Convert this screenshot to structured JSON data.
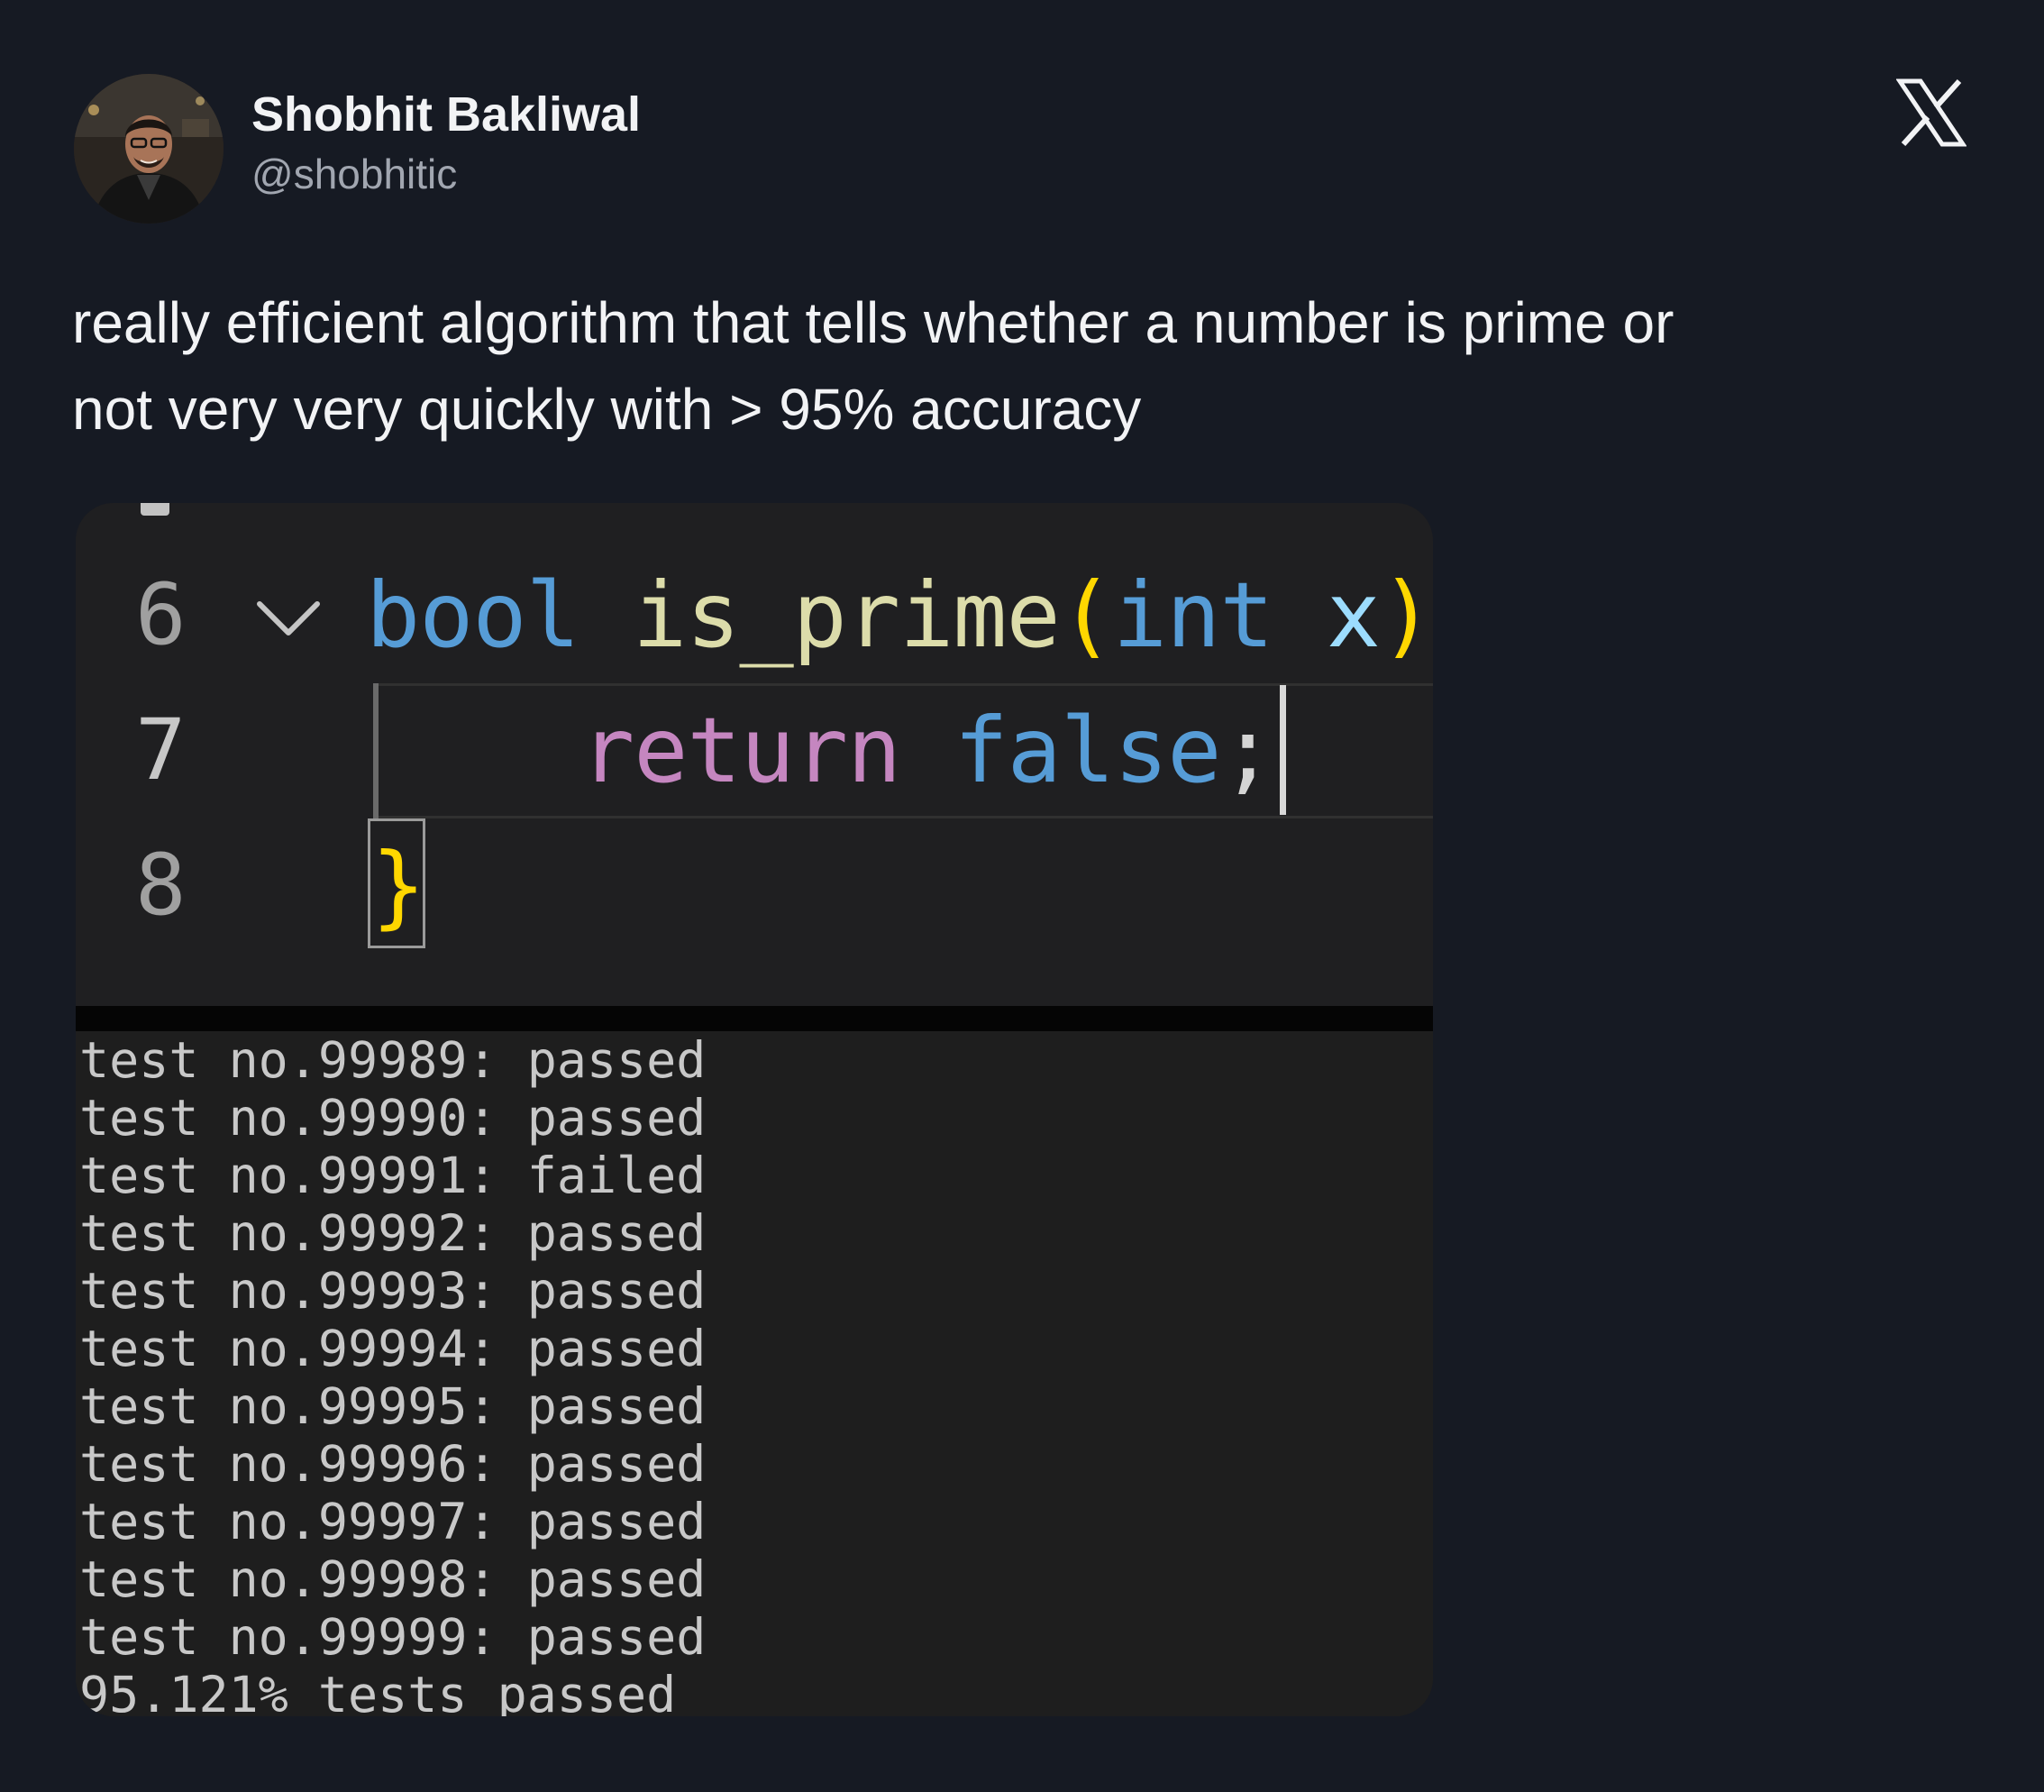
{
  "author": {
    "name": "Shobhit Bakliwal",
    "handle": "@shobhitic"
  },
  "platform_icon": "x-logo-icon",
  "tweet": {
    "text": "really efficient algorithm that tells whether a number is prime or\nnot very very quickly with > 95% accuracy"
  },
  "editor": {
    "lines": [
      {
        "number": "6",
        "tokens": {
          "t1": "bool",
          "t2": " ",
          "t3": "is_prime",
          "t4": "(",
          "t5": "int",
          "t6": " x",
          "t7": ")"
        }
      },
      {
        "number": "7",
        "tokens": {
          "t1": "return",
          "t2": " ",
          "t3": "false",
          "t4": ";"
        }
      },
      {
        "number": "8",
        "tokens": {
          "t1": "}"
        }
      }
    ],
    "fold_icon": "chevron-down-icon"
  },
  "terminal": {
    "results": [
      {
        "label": "test no.99989:",
        "status": "passed"
      },
      {
        "label": "test no.99990:",
        "status": "passed"
      },
      {
        "label": "test no.99991:",
        "status": "failed"
      },
      {
        "label": "test no.99992:",
        "status": "passed"
      },
      {
        "label": "test no.99993:",
        "status": "passed"
      },
      {
        "label": "test no.99994:",
        "status": "passed"
      },
      {
        "label": "test no.99995:",
        "status": "passed"
      },
      {
        "label": "test no.99996:",
        "status": "passed"
      },
      {
        "label": "test no.99997:",
        "status": "passed"
      },
      {
        "label": "test no.99998:",
        "status": "passed"
      },
      {
        "label": "test no.99999:",
        "status": "passed"
      }
    ],
    "summary": "95.121% tests passed"
  },
  "colors": {
    "background": "#161a23",
    "keyword": "#569cd6",
    "function": "#dcdcaa",
    "bracket": "#ffd700",
    "param": "#9cdcfe",
    "control": "#c586c0"
  }
}
